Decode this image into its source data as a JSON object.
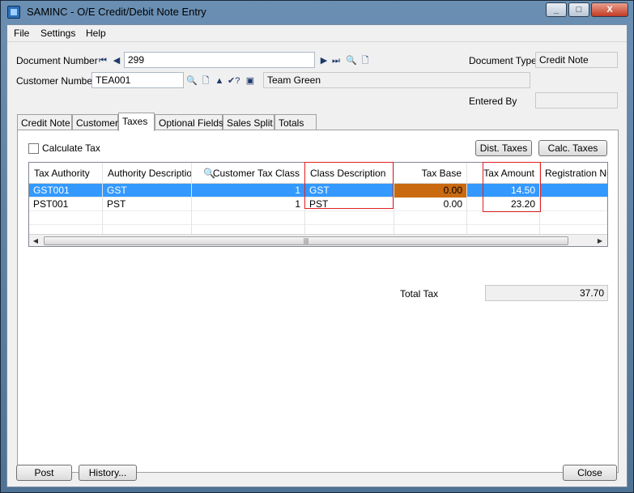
{
  "window": {
    "title": "SAMINC - O/E Credit/Debit Note Entry",
    "minimize": "_",
    "maximize": "□",
    "close": "X"
  },
  "menu": {
    "file": "File",
    "settings": "Settings",
    "help": "Help"
  },
  "header": {
    "document_number_label": "Document Number",
    "document_number": "299",
    "document_type_label": "Document Type",
    "document_type": "Credit Note",
    "customer_number_label": "Customer Number",
    "customer_number": "TEA001",
    "customer_name": "Team Green",
    "entered_by_label": "Entered By",
    "entered_by": ""
  },
  "tabs": [
    "Credit Note",
    "Customer",
    "Taxes",
    "Optional Fields",
    "Sales Split",
    "Totals"
  ],
  "active_tab": "Taxes",
  "taxes": {
    "calculate_tax_label": "Calculate Tax",
    "calculate_tax_checked": false,
    "dist_taxes_button": "Dist. Taxes",
    "calc_taxes_button": "Calc. Taxes",
    "columns": [
      "Tax Authority",
      "Authority Description",
      "Customer Tax Class",
      "Class Description",
      "Tax Base",
      "Tax Amount",
      "Registration Num"
    ],
    "rows": [
      {
        "authority": "GST001",
        "description": "GST",
        "tax_class": "1",
        "class_description": "GST",
        "tax_base": "0.00",
        "tax_amount": "14.50",
        "registration": ""
      },
      {
        "authority": "PST001",
        "description": "PST",
        "tax_class": "1",
        "class_description": "PST",
        "tax_base": "0.00",
        "tax_amount": "23.20",
        "registration": ""
      }
    ],
    "total_tax_label": "Total Tax",
    "total_tax": "37.70"
  },
  "footer": {
    "post_button": "Post",
    "history_button": "History...",
    "close_button": "Close"
  },
  "colors": {
    "selection": "#3399ff",
    "highlight_cell": "#c96a10",
    "annotation_box": "#e02020"
  }
}
